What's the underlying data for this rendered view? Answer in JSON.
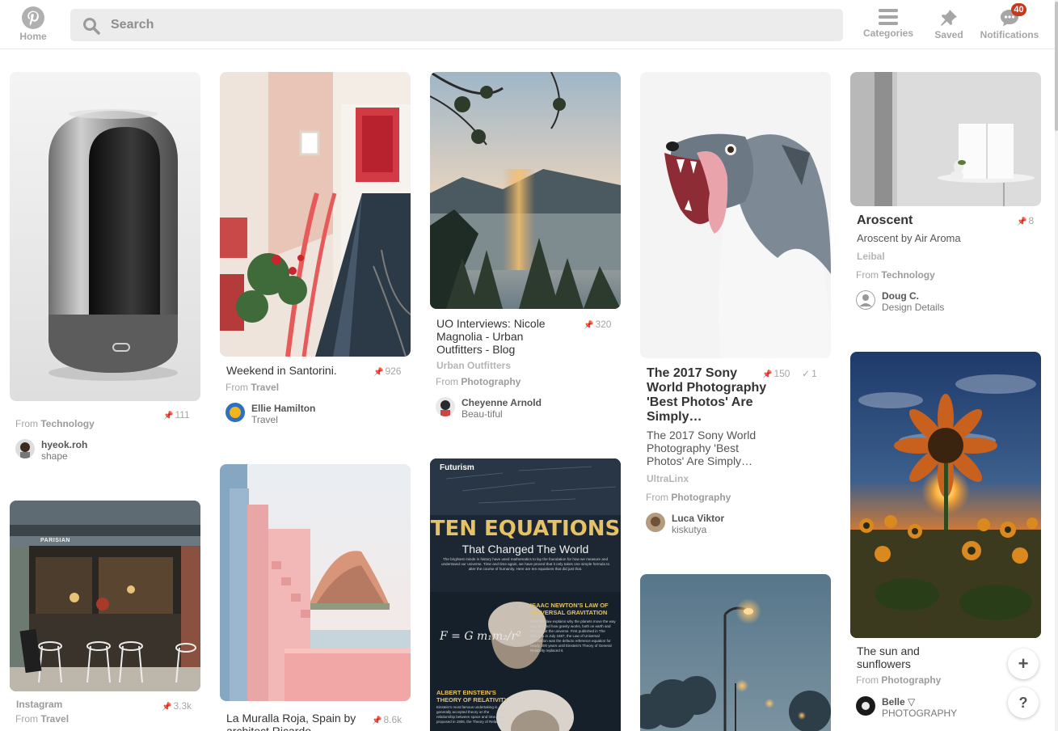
{
  "header": {
    "home_label": "Home",
    "search_placeholder": "Search",
    "categories_label": "Categories",
    "saved_label": "Saved",
    "notifications_label": "Notifications",
    "notifications_count": "40"
  },
  "colors": {
    "brand": "#b0b0b0",
    "badge": "#c8381e",
    "search_bg": "#ececec"
  },
  "pins": [
    {
      "id": "speaker",
      "count": "111",
      "from_prefix": "From",
      "from_category": "Technology",
      "pinner_name": "hyeok.roh",
      "pinner_board": "shape"
    },
    {
      "id": "santorini",
      "title": "Weekend in Santorini.",
      "count": "926",
      "from_prefix": "From",
      "from_category": "Travel",
      "pinner_name": "Ellie Hamilton",
      "pinner_board": "Travel"
    },
    {
      "id": "uo",
      "title": "UO Interviews: Nicole Magnolia - Urban Outfitters - Blog",
      "count": "320",
      "domain": "Urban Outfitters",
      "from_prefix": "From",
      "from_category": "Photography",
      "pinner_name": "Cheyenne Arnold",
      "pinner_board": "Beau-tiful"
    },
    {
      "id": "dog",
      "title": "The 2017 Sony World Photography 'Best Photos' Are Simply…",
      "description": "The 2017 Sony World Photography 'Best Photos' Are Simply…",
      "count": "150",
      "check_count": "1",
      "domain": "UltraLinx",
      "from_prefix": "From",
      "from_category": "Photography",
      "pinner_name": "Luca Viktor",
      "pinner_board": "kiskutya"
    },
    {
      "id": "aroscent",
      "title": "Aroscent",
      "description": "Aroscent by Air Aroma",
      "count": "8",
      "domain": "Leibal",
      "from_prefix": "From",
      "from_category": "Technology",
      "pinner_name": "Doug C.",
      "pinner_board": "Design Details"
    },
    {
      "id": "cafe",
      "title": "Instagram",
      "count": "3.3k",
      "from_prefix": "From",
      "from_category": "Travel",
      "shop_sign": "PARISIAN"
    },
    {
      "id": "muralla",
      "title": "La Muralla Roja, Spain by architect Ricardo",
      "count": "8.6k"
    },
    {
      "id": "equations",
      "brand": "Futurism",
      "headline": "TEN EQUATIONS",
      "subheadline": "That Changed The World",
      "intro": "The brightest minds in history have used mathematics to lay the foundation for how we measure and understand our universe. Time and time again, we have proved that it only takes one simple formula to alter the course of humanity. Here are ten equations that did just that.",
      "section1_title": "ISAAC NEWTON'S LAW OF UNIVERSAL GRAVITATION",
      "section1_body": "Newton's law explains why the planets move the way they do, and how gravity works, both on earth and throughout the universe. First published in The Principia in July 1687, the Law of Universal Gravitation was the defacto reference equation for nearly 200 years until Einstein's Theory of General Relativity replaced it.",
      "section2_title": "ALBERT EINSTEIN'S THEORY OF RELATIVITY",
      "section2_body": "Einstein's most famous undertaking is generally accepted theory on the relationship between space and time. First proposed in 1905, the Theory of Relativity"
    },
    {
      "id": "streetlamp"
    },
    {
      "id": "sunflower",
      "title": "The sun and sunflowers",
      "from_prefix": "From",
      "from_category": "Photography",
      "pinner_name": "Belle ▽",
      "pinner_board": "PHOTOGRAPHY"
    }
  ]
}
